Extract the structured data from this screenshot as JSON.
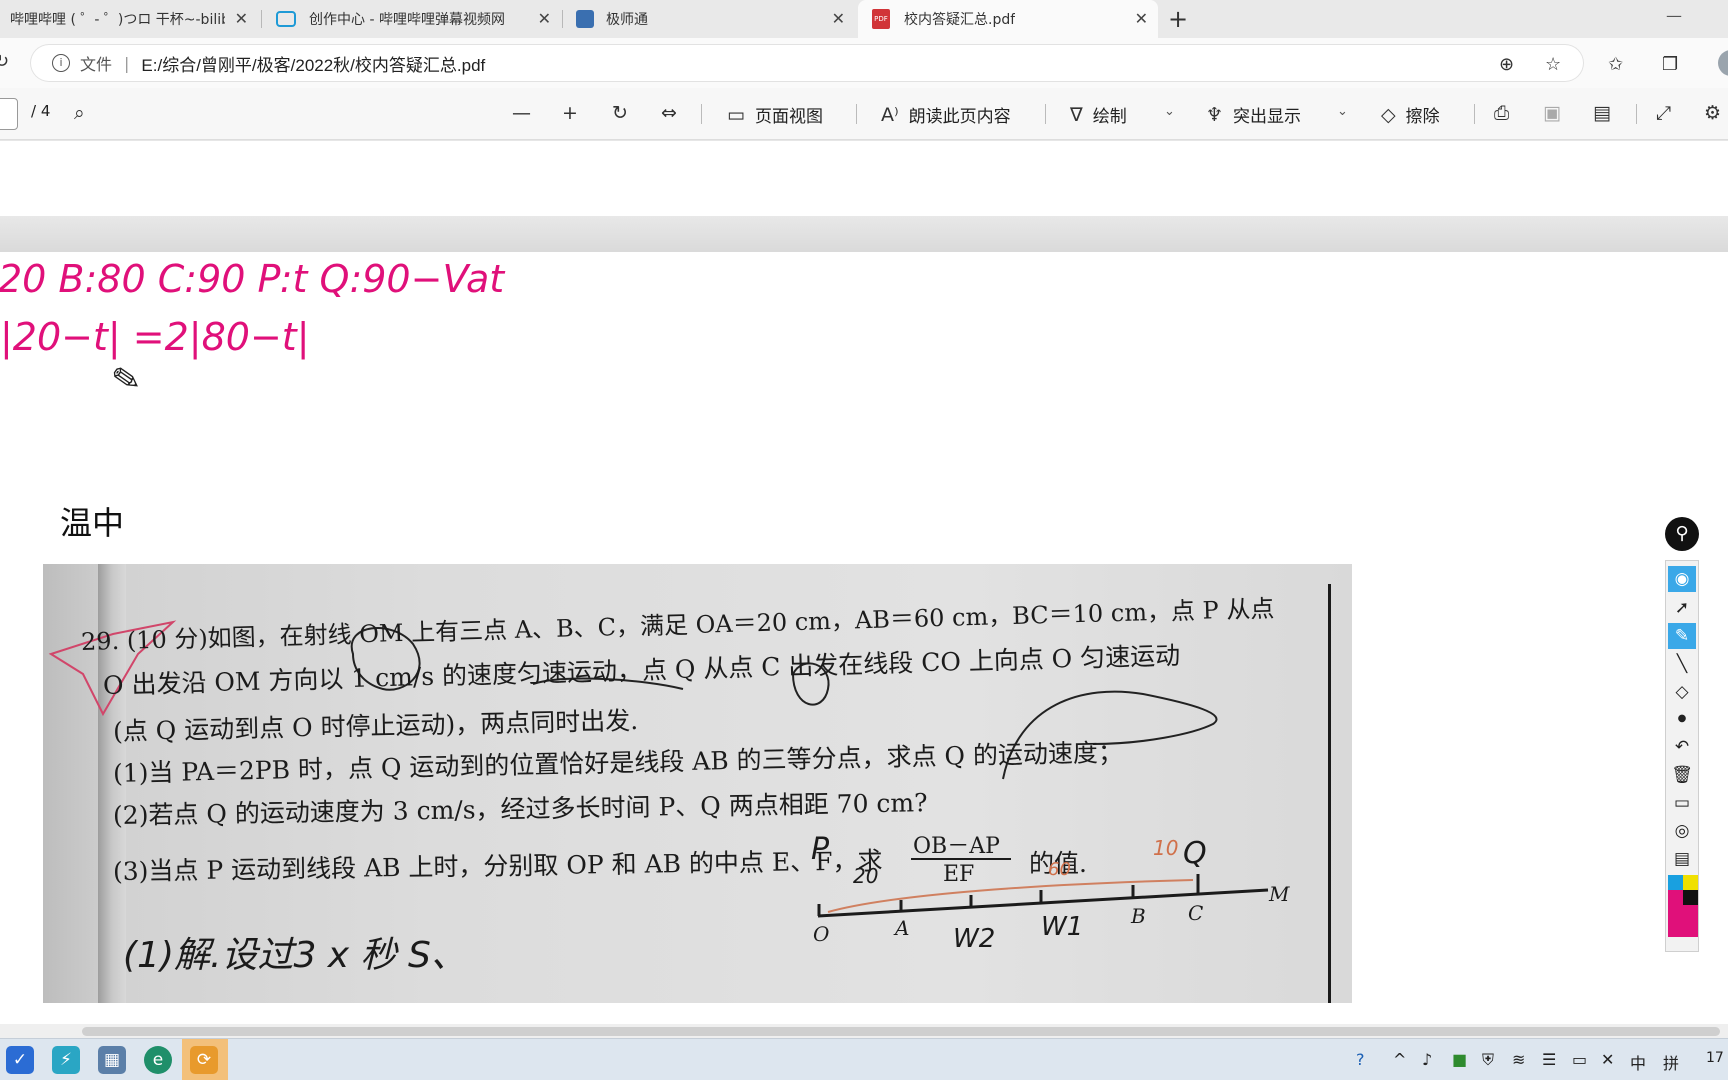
{
  "tabs": [
    {
      "title": "哔哩哔哩 ( ゜- ゜)つロ 干杯~-bilib",
      "active": false
    },
    {
      "title": "创作中心 - 哔哩哔哩弹幕视频网",
      "active": false
    },
    {
      "title": "极师通",
      "active": false
    },
    {
      "title": "校内答疑汇总.pdf",
      "active": true
    }
  ],
  "address": {
    "scheme_label": "文件",
    "url": "E:/综合/曾刚平/极客/2022秋/校内答疑汇总.pdf"
  },
  "pdf_toolbar": {
    "page_total": "/ 4",
    "page_view": "页面视图",
    "read_aloud": "朗读此页内容",
    "draw": "绘制",
    "highlight": "突出显示",
    "erase": "擦除"
  },
  "page": {
    "heading": "温中",
    "ink_line1": "20  B:80  C:90     P:t      Q:90−Vat",
    "ink_line2": "|20−t| =2|80−t|"
  },
  "problem": {
    "line1": "O、A、B、C，满足 OA＝20 cm，AB＝60 cm，BC＝10 cm，点 P 从点",
    "line0": "29. (10 分)如图，在射线 OM 上有三点 A、B、C，满足 OA＝20 cm，AB＝60 cm，BC＝10 cm，点 P 从点",
    "l_a": "29. (10 分)如图，在射线 OM 上有三点 A、B、C，满足 OA＝20 cm，AB＝60 cm，BC＝10 cm，点 P 从点",
    "line2": "O 出发沿 OM 方向以 1 cm/s 的速度匀速运动，点 Q 从点 C 出发在线段 CO 上向点 O 匀速运动",
    "line3": "(点 Q 运动到点 O 时停止运动)，两点同时出发.",
    "line4": "(1)当 PA＝2PB 时，点 Q 运动到的位置恰好是线段 AB 的三等分点，求点 Q 的运动速度；",
    "line5": "(2)若点 Q 的运动速度为 3 cm/s，经过多长时间 P、Q 两点相距 70 cm?",
    "line6": "(3)当点 P 运动到线段 AB 上时，分别取 OP 和 AB 的中点 E、F，求",
    "frac_num": "OB－AP",
    "frac_den": "EF",
    "line6_end": "的值.",
    "fig_labels": [
      "O",
      "A",
      "B",
      "C",
      "M"
    ],
    "handwriting": "(1)解.设过3 x 秒 S、",
    "hand_marks": [
      "20",
      "60",
      "10",
      "W2",
      "W1",
      "P",
      "Q"
    ]
  },
  "taskbar": {
    "ime": "中",
    "ime2": "拼",
    "clock": "17"
  }
}
